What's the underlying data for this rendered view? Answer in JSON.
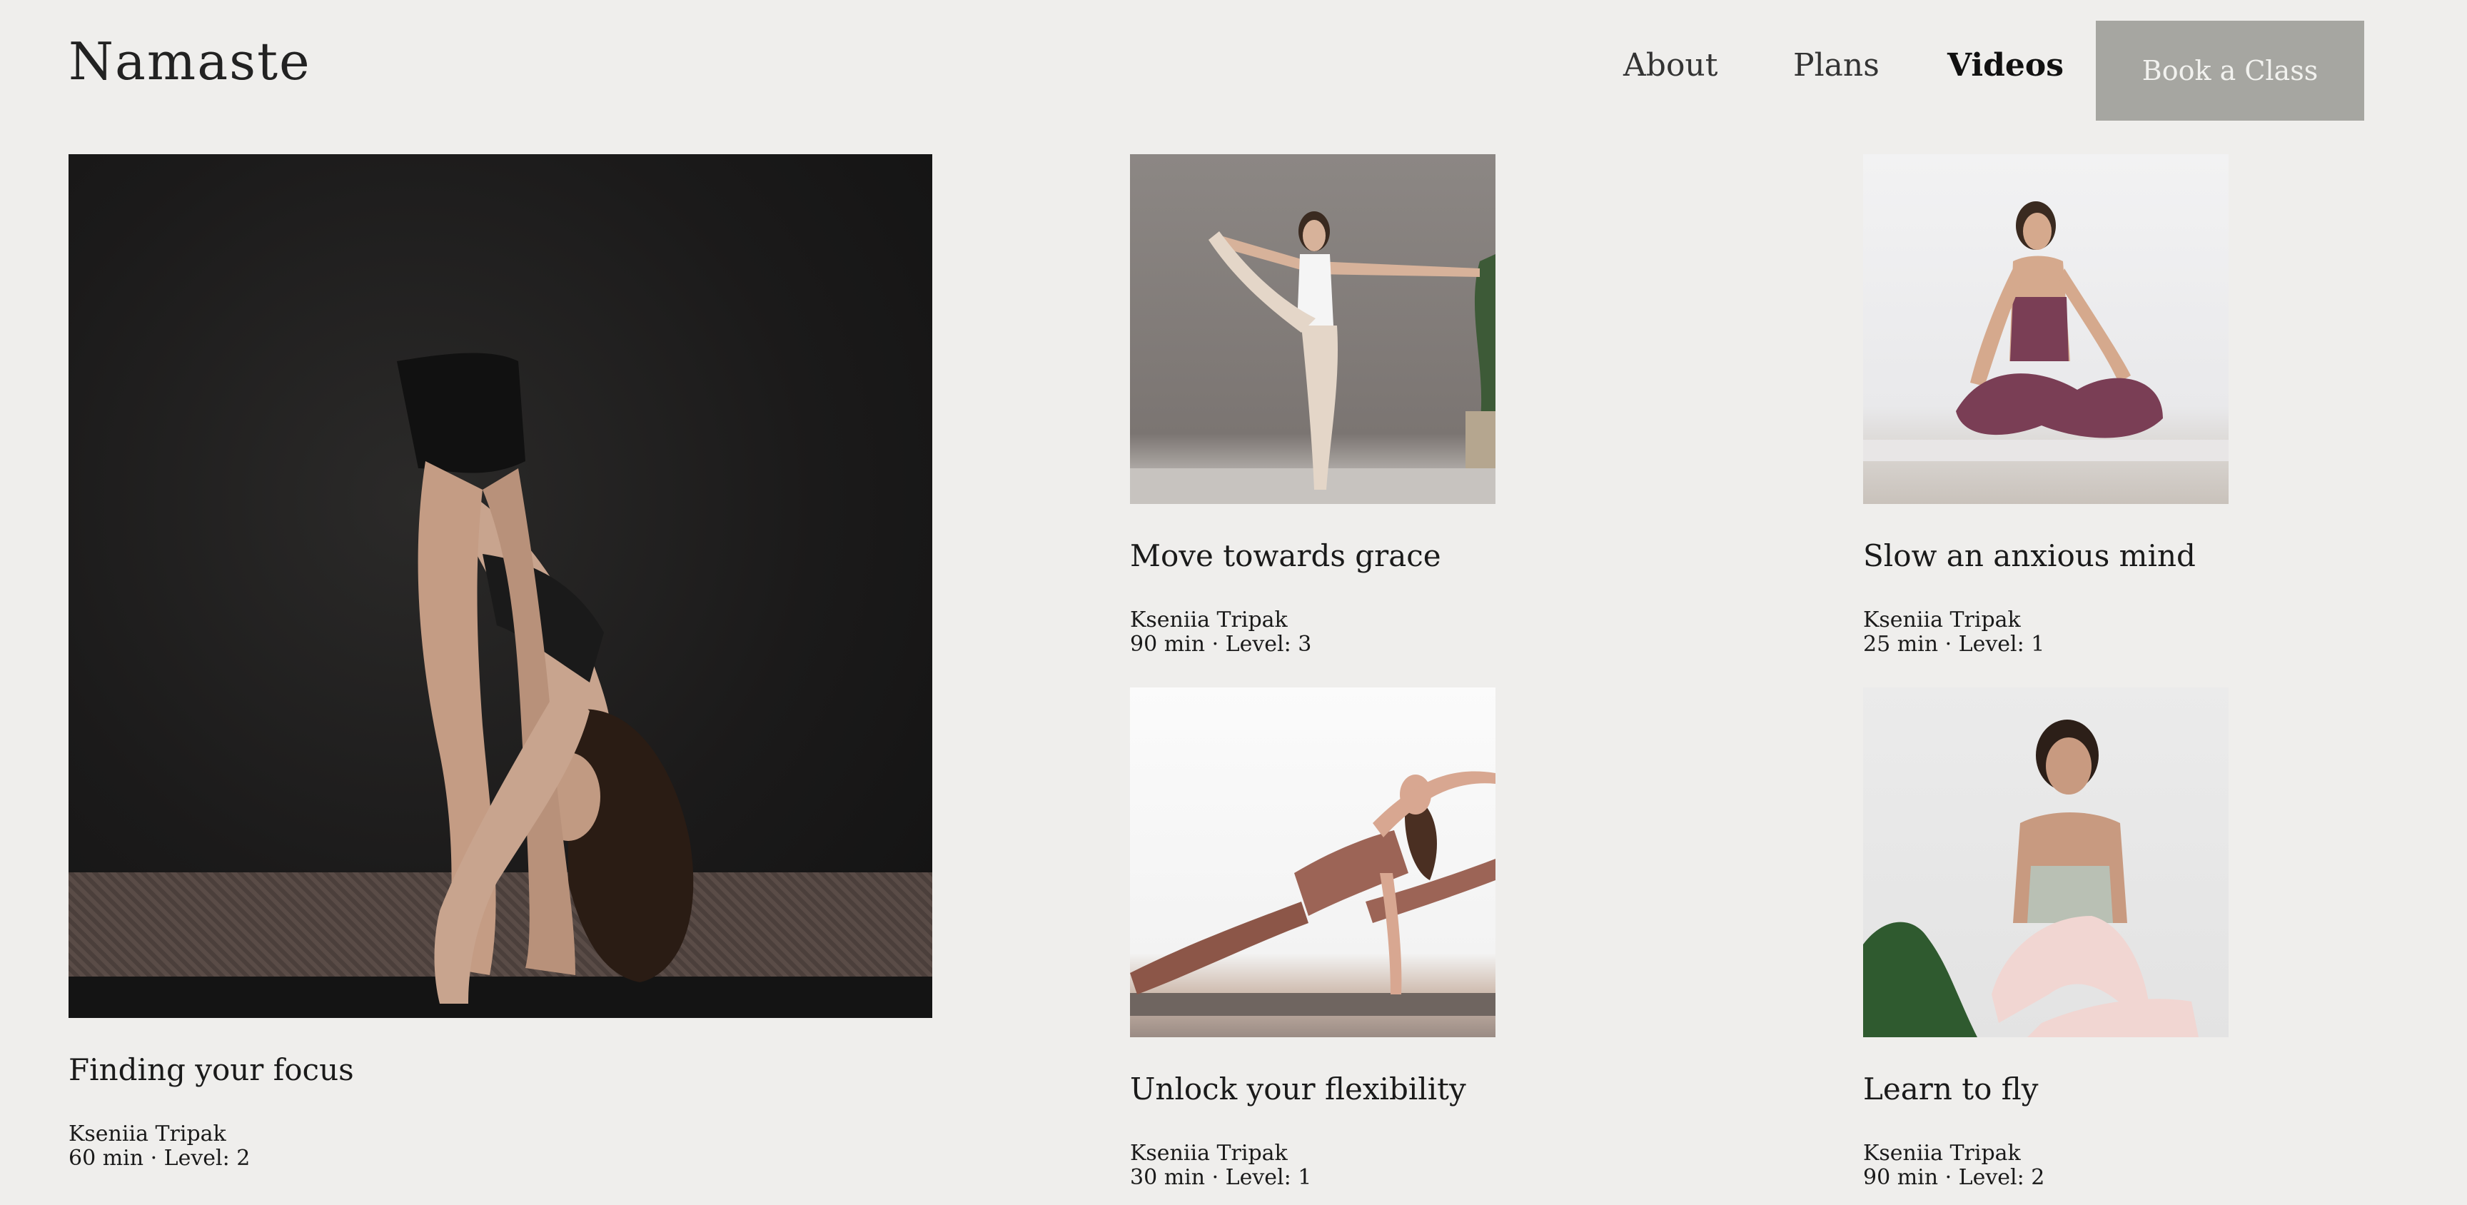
{
  "header": {
    "logo": "Namaste",
    "nav": [
      {
        "label": "About"
      },
      {
        "label": "Plans"
      },
      {
        "label": "Videos",
        "active": true
      }
    ],
    "cta_label": "Book a Class"
  },
  "colors": {
    "background": "#efeeec",
    "cta_bg": "#a6a6a1",
    "cta_text": "#f2f2ef"
  },
  "videos": [
    {
      "title": "Finding your focus",
      "instructor": "Kseniia Tripak",
      "details": "60 min · Level: 2",
      "image_icon": "yoga-forward-fold-photo"
    },
    {
      "title": "Move towards grace",
      "instructor": "Kseniia Tripak",
      "details": "90 min · Level: 3",
      "image_icon": "yoga-standing-balance-photo"
    },
    {
      "title": "Slow an anxious mind",
      "instructor": "Kseniia Tripak",
      "details": "25 min · Level: 1",
      "image_icon": "yoga-meditation-photo"
    },
    {
      "title": "Unlock your flexibility",
      "instructor": "Kseniia Tripak",
      "details": "30 min · Level: 1",
      "image_icon": "yoga-side-stretch-photo"
    },
    {
      "title": "Learn to fly",
      "instructor": "Kseniia Tripak",
      "details": "90 min · Level: 2",
      "image_icon": "yoga-seated-smile-photo"
    }
  ]
}
